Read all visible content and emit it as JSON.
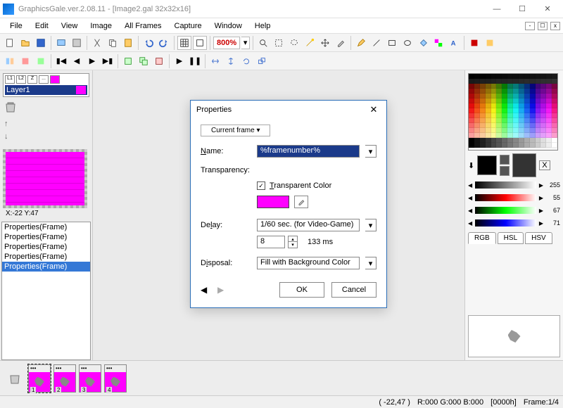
{
  "titlebar": {
    "title": "GraphicsGale.ver.2.08.11 - [Image2.gal 32x32x16]"
  },
  "winbtns": {
    "min": "—",
    "max": "☐",
    "close": "✕"
  },
  "menu": [
    "File",
    "Edit",
    "View",
    "Image",
    "All Frames",
    "Capture",
    "Window",
    "Help"
  ],
  "toolbar": {
    "zoom": "800%"
  },
  "left": {
    "layer_label": "Layer1",
    "coord": "X:-22 Y:47",
    "history": [
      "Properties(Frame)",
      "Properties(Frame)",
      "Properties(Frame)",
      "Properties(Frame)",
      "Properties(Frame)"
    ]
  },
  "sliders": {
    "l": "255",
    "r": "55",
    "g": "67",
    "b": "71"
  },
  "color_tabs": [
    "RGB",
    "HSL",
    "HSV"
  ],
  "frames": [
    "1",
    "2",
    "3",
    "4"
  ],
  "status": {
    "coord": "( -22,47 )",
    "rgb": "R:000 G:000 B:000",
    "hex": "[0000h]",
    "frame": "Frame:1/4"
  },
  "dialog": {
    "title": "Properties",
    "current_frame": "Current frame ▾",
    "name_label": "Name:",
    "name_value": "%framenumber%",
    "transparency_label": "Transparency:",
    "tc_label": "Transparent Color",
    "color_hex": "#ff00ff",
    "delay_label": "Delay:",
    "delay_unit": "1/60 sec. (for Video-Game)",
    "delay_value": "8",
    "delay_ms": "133 ms",
    "disposal_label": "Disposal:",
    "disposal_value": "Fill with Background Color",
    "ok": "OK",
    "cancel": "Cancel"
  }
}
